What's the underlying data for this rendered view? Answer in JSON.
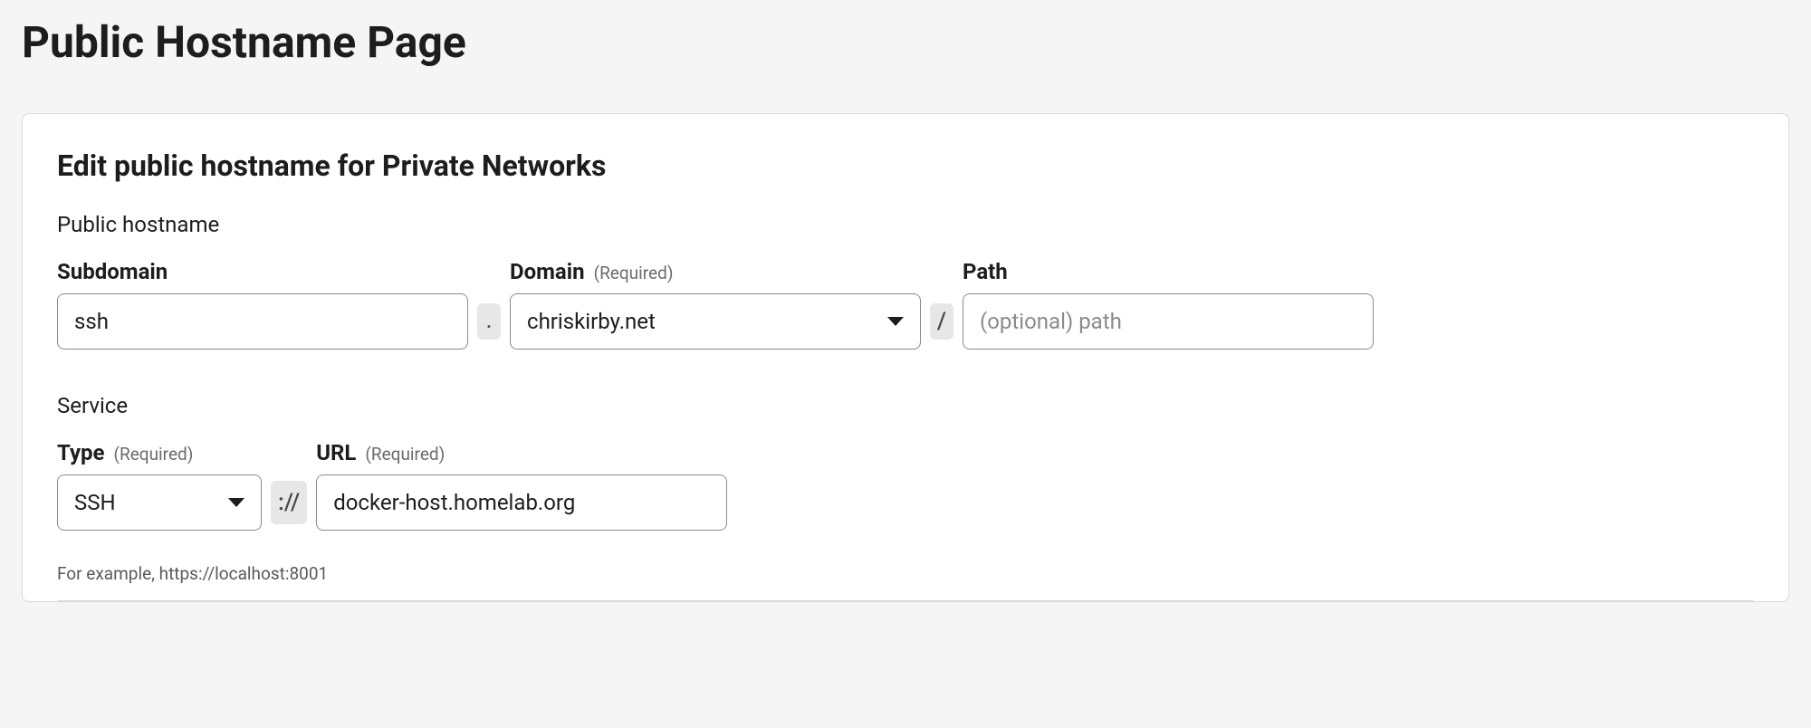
{
  "page": {
    "title": "Public Hostname Page"
  },
  "card": {
    "heading": "Edit public hostname for Private Networks",
    "hostname_section_label": "Public hostname",
    "service_section_label": "Service",
    "example_text": "For example, https://localhost:8001"
  },
  "labels": {
    "subdomain": "Subdomain",
    "domain": "Domain",
    "path": "Path",
    "type": "Type",
    "url": "URL",
    "required": "(Required)"
  },
  "separators": {
    "dot": ".",
    "slash": "/",
    "scheme": "://"
  },
  "values": {
    "subdomain": "ssh",
    "domain": "chriskirby.net",
    "path": "",
    "type": "SSH",
    "url": "docker-host.homelab.org"
  },
  "placeholders": {
    "path": "(optional) path"
  }
}
